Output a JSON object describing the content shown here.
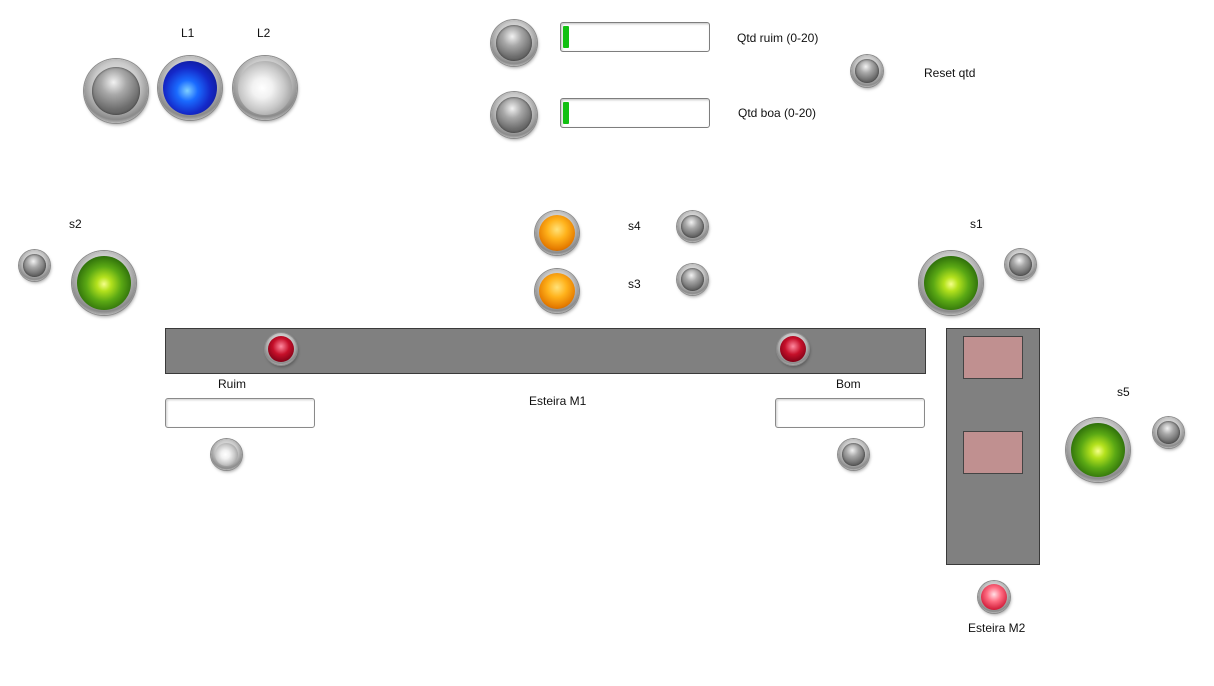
{
  "top_lamps": {
    "l1_label": "L1",
    "l2_label": "L2"
  },
  "counters": {
    "ruim": {
      "label": "Qtd ruim (0-20)",
      "value": 0,
      "max": 20
    },
    "boa": {
      "label": "Qtd boa (0-20)",
      "value": 0,
      "max": 20
    },
    "reset_label": "Reset qtd"
  },
  "sensors": {
    "s1": "s1",
    "s2": "s2",
    "s3": "s3",
    "s4": "s4",
    "s5": "s5"
  },
  "belt_m1": {
    "label": "Esteira M1",
    "ruim_label": "Ruim",
    "ruim_value": "",
    "bom_label": "Bom",
    "bom_value": ""
  },
  "belt_m2": {
    "label": "Esteira M2"
  },
  "colors": {
    "belt": "#808080",
    "box": "#c09090",
    "bar_fill": "#12c012",
    "lamp_green": "#5aa814",
    "lamp_orange": "#e57b00",
    "lamp_red": "#c6102a",
    "lamp_blue": "#1428c8"
  }
}
